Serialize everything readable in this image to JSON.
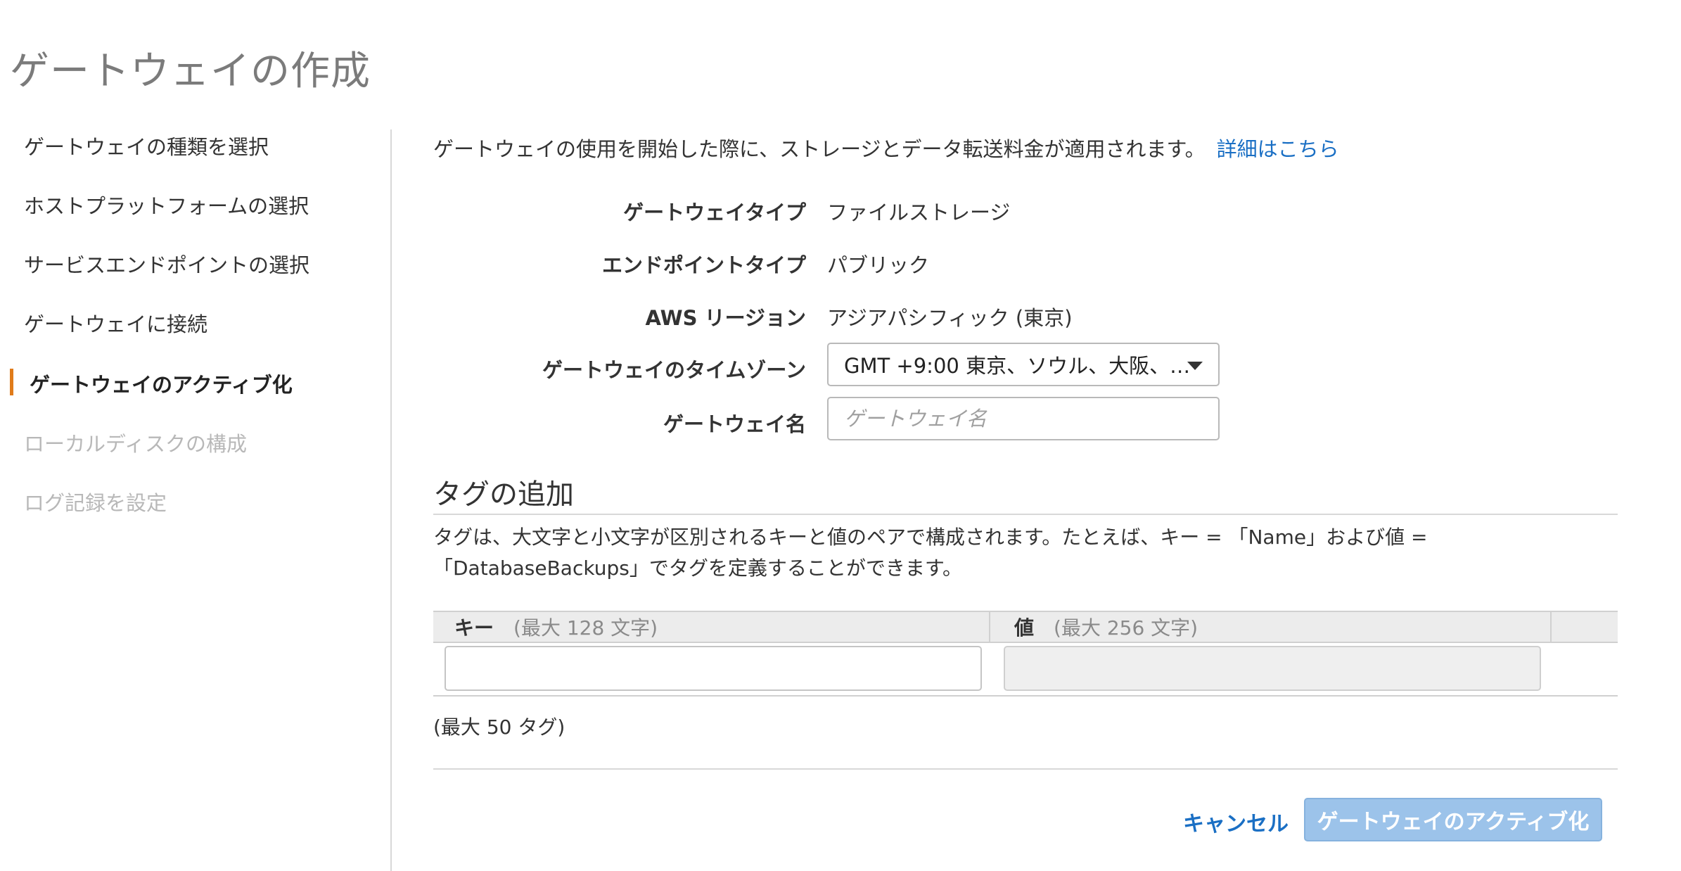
{
  "page": {
    "title": "ゲートウェイの作成"
  },
  "sidebar": {
    "items": [
      {
        "label": "ゲートウェイの種類を選択"
      },
      {
        "label": "ホストプラットフォームの選択"
      },
      {
        "label": "サービスエンドポイントの選択"
      },
      {
        "label": "ゲートウェイに接続"
      },
      {
        "label": "ゲートウェイのアクティブ化"
      },
      {
        "label": "ローカルディスクの構成"
      },
      {
        "label": "ログ記録を設定"
      }
    ],
    "active_index": 4,
    "accent_color": "#e07b1a"
  },
  "intro": {
    "text": "ゲートウェイの使用を開始した際に、ストレージとデータ転送料金が適用されます。",
    "link": "詳細はこちら"
  },
  "details": {
    "gateway_type_label": "ゲートウェイタイプ",
    "gateway_type_value": "ファイルストレージ",
    "endpoint_type_label": "エンドポイントタイプ",
    "endpoint_type_value": "パブリック",
    "region_label": "AWS リージョン",
    "region_value": "アジアパシフィック (東京)",
    "timezone_label": "ゲートウェイのタイムゾーン",
    "timezone_value": "GMT +9:00 東京、ソウル、大阪、…",
    "name_label": "ゲートウェイ名",
    "name_value": "",
    "name_placeholder": "ゲートウェイ名"
  },
  "tags": {
    "title": "タグの追加",
    "description": "タグは、大文字と小文字が区別されるキーと値のペアで構成されます。たとえば、キー = 「Name」および値 = 「DatabaseBackups」でタグを定義することができます。",
    "key_header": "キー",
    "key_hint": "(最大 128 文字)",
    "value_header": "値",
    "value_hint": "(最大 256 文字)",
    "limit": "(最大 50 タグ)"
  },
  "footer": {
    "cancel_label": "キャンセル",
    "activate_label": "ゲートウェイのアクティブ化"
  },
  "colors": {
    "link": "#1a6fc4",
    "primary_disabled": "#9cc3ea"
  }
}
